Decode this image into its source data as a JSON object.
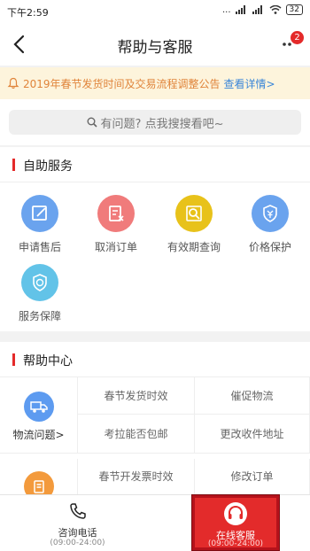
{
  "status": {
    "time": "下午2:59",
    "network": "...",
    "battery": "32"
  },
  "nav": {
    "title": "帮助与客服",
    "badge": "2"
  },
  "notice": {
    "text": "2019年春节发货时间及交易流程调整公告",
    "link": "查看详情>"
  },
  "search": {
    "placeholder": "有问题? 点我搜搜看吧~"
  },
  "self_service": {
    "title": "自助服务",
    "items": [
      {
        "label": "申请售后",
        "icon": "edit-icon",
        "color": "#6aa3ee"
      },
      {
        "label": "取消订单",
        "icon": "cancel-order-icon",
        "color": "#f07b7b"
      },
      {
        "label": "有效期查询",
        "icon": "search-icon",
        "color": "#e8c21a"
      },
      {
        "label": "价格保护",
        "icon": "price-shield-icon",
        "color": "#6aa3ee"
      },
      {
        "label": "服务保障",
        "icon": "service-shield-icon",
        "color": "#62c3e8"
      }
    ]
  },
  "help_center": {
    "title": "帮助中心",
    "logistics": {
      "label": "物流问题>",
      "icon": "truck-icon",
      "color": "#5d9bf0",
      "cells": [
        "春节发货时效",
        "催促物流",
        "考拉能否包邮",
        "更改收件地址"
      ]
    },
    "orders": {
      "icon": "order-icon",
      "color": "#f39a3c",
      "cells": [
        "春节开发票时效",
        "修改订单"
      ]
    }
  },
  "bottom": {
    "phone": {
      "label": "咨询电话",
      "hours": "(09:00-24:00)"
    },
    "chat": {
      "label": "在线客服",
      "hours": "(09:00-24:00)"
    }
  }
}
